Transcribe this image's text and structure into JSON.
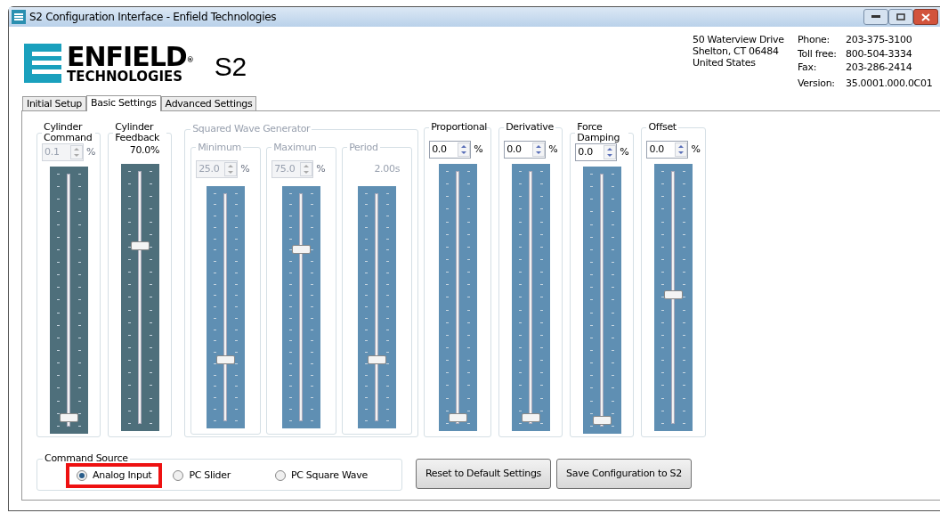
{
  "window": {
    "title": "S2 Configuration Interface - Enfield Technologies"
  },
  "logo": {
    "name": "ENFIELD",
    "mark": "®",
    "subtitle": "TECHNOLOGIES"
  },
  "product": "S2",
  "address": [
    "50 Waterview Drive",
    "Shelton, CT 06484",
    "United States"
  ],
  "contacts": [
    {
      "label": "Phone:",
      "value": "203-375-3100"
    },
    {
      "label": "Toll free:",
      "value": "800-504-3334"
    },
    {
      "label": "Fax:",
      "value": "203-286-2414"
    },
    {
      "label": "Version:",
      "value": "35.0001.000.0C01"
    }
  ],
  "tabs": [
    {
      "label": "Initial Setup",
      "selected": false
    },
    {
      "label": "Basic Settings",
      "selected": true
    },
    {
      "label": "Advanced Settings",
      "selected": false
    }
  ],
  "groups": [
    {
      "kind": "single",
      "label": "Cylinder Command",
      "disabled": false,
      "control": {
        "kind": "spin",
        "value": "0.1",
        "unit": "%",
        "disabled": true
      },
      "slider": {
        "level": 0.01,
        "readonly": true
      }
    },
    {
      "kind": "single",
      "label": "Cylinder Feedback",
      "disabled": false,
      "control": {
        "kind": "reading",
        "value": "70.0%"
      },
      "slider": {
        "level": 0.7,
        "readonly": true
      }
    },
    {
      "kind": "set",
      "label": "Squared Wave Generator",
      "disabled": true,
      "children": [
        {
          "label": "Minimum",
          "control": {
            "kind": "spin",
            "value": "25.0",
            "unit": "%",
            "disabled": true
          },
          "slider": {
            "level": 0.25,
            "readonly": false
          }
        },
        {
          "label": "Maximun",
          "control": {
            "kind": "spin",
            "value": "75.0",
            "unit": "%",
            "disabled": true
          },
          "slider": {
            "level": 0.75,
            "readonly": false
          }
        },
        {
          "label": "Period",
          "control": {
            "kind": "reading",
            "value": "2.00s"
          },
          "slider": {
            "level": 0.25,
            "readonly": false
          }
        }
      ]
    },
    {
      "kind": "single",
      "label": "Proportional",
      "disabled": false,
      "control": {
        "kind": "spin",
        "value": "0.0",
        "unit": "%",
        "disabled": false
      },
      "slider": {
        "level": 0.0,
        "readonly": false
      }
    },
    {
      "kind": "single",
      "label": "Derivative",
      "disabled": false,
      "control": {
        "kind": "spin",
        "value": "0.0",
        "unit": "%",
        "disabled": false
      },
      "slider": {
        "level": 0.0,
        "readonly": false
      }
    },
    {
      "kind": "single",
      "label": "Force Damping",
      "disabled": false,
      "control": {
        "kind": "spin",
        "value": "0.0",
        "unit": "%",
        "disabled": false
      },
      "slider": {
        "level": 0.0,
        "readonly": false
      }
    },
    {
      "kind": "single",
      "label": "Offset",
      "disabled": false,
      "control": {
        "kind": "spin",
        "value": "0.0",
        "unit": "%",
        "disabled": false
      },
      "slider": {
        "level": 0.5,
        "readonly": false
      }
    }
  ],
  "command_source": {
    "label": "Command Source",
    "options": [
      {
        "label": "Analog Input",
        "selected": true,
        "highlighted": true
      },
      {
        "label": "PC Slider",
        "selected": false,
        "highlighted": false
      },
      {
        "label": "PC Square Wave",
        "selected": false,
        "highlighted": false
      }
    ]
  },
  "buttons": [
    "Reset to Default Settings",
    "Save Configuration to S2"
  ]
}
